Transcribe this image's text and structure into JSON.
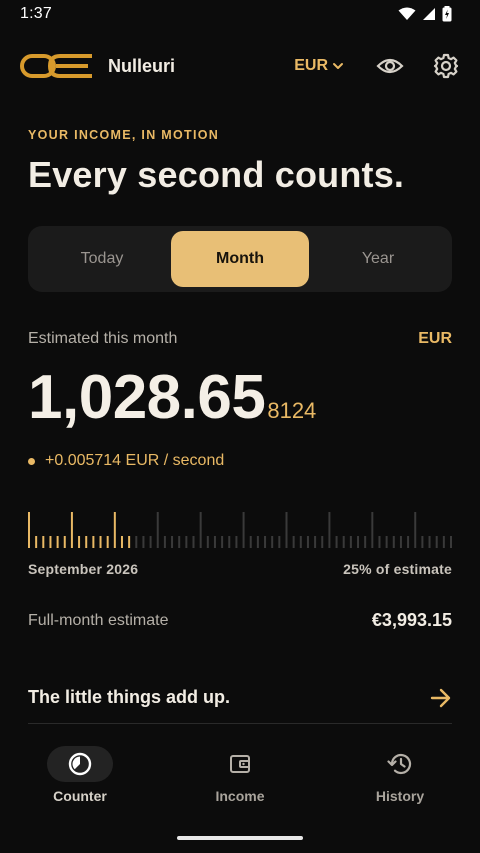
{
  "status_bar": {
    "time": "1:37"
  },
  "app_bar": {
    "logo_text": "OE",
    "title": "Nulleuri",
    "currency_selector": "EUR",
    "icons": {
      "visibility": "eye-icon",
      "settings": "gear-icon"
    }
  },
  "hero": {
    "eyebrow": "YOUR INCOME, IN MOTION",
    "headline": "Every second counts."
  },
  "period_tabs": [
    {
      "label": "Today",
      "active": false
    },
    {
      "label": "Month",
      "active": true
    },
    {
      "label": "Year",
      "active": false
    }
  ],
  "estimate": {
    "label": "Estimated this month",
    "currency": "EUR",
    "value_main": "1,028.65",
    "value_fraction": "8124",
    "rate": "+0.005714 EUR / second"
  },
  "progress": {
    "period": "September 2026",
    "percent_label": "25% of estimate",
    "fraction": 0.25,
    "accent_color": "#e9b965",
    "track_color": "#3a3a3a"
  },
  "full_month": {
    "label": "Full-month estimate",
    "value": "€3,993.15"
  },
  "little_things": {
    "label": "The little things add up."
  },
  "bottom_nav": [
    {
      "label": "Counter",
      "icon": "timer-icon",
      "active": true
    },
    {
      "label": "Income",
      "icon": "wallet-icon",
      "active": false
    },
    {
      "label": "History",
      "icon": "history-icon",
      "active": false
    }
  ]
}
